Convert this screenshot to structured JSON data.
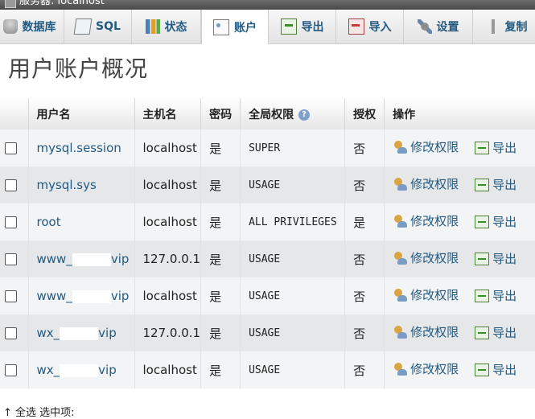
{
  "topbar": {
    "server_label": "服务器: localhost"
  },
  "tabs": [
    {
      "label": "数据库",
      "icon": "database-icon"
    },
    {
      "label": "SQL",
      "icon": "sql-icon"
    },
    {
      "label": "状态",
      "icon": "status-icon"
    },
    {
      "label": "账户",
      "icon": "accounts-icon",
      "active": true
    },
    {
      "label": "导出",
      "icon": "export-icon"
    },
    {
      "label": "导入",
      "icon": "import-icon"
    },
    {
      "label": "设置",
      "icon": "settings-icon"
    },
    {
      "label": "复制",
      "icon": "replication-icon"
    }
  ],
  "page_title": "用户账户概况",
  "table": {
    "headers": [
      "用户名",
      "主机名",
      "密码",
      "全局权限",
      "授权",
      "操作"
    ],
    "rows": [
      {
        "user_start": "mysql.session",
        "user_end": "",
        "host": "localhost",
        "password": "是",
        "privileges": "SUPER",
        "grant": "否"
      },
      {
        "user_start": "mysql.sys",
        "user_end": "",
        "host": "localhost",
        "password": "是",
        "privileges": "USAGE",
        "grant": "否"
      },
      {
        "user_start": "root",
        "user_end": "",
        "host": "localhost",
        "password": "是",
        "privileges": "ALL PRIVILEGES",
        "grant": "是"
      },
      {
        "user_start": "www_",
        "user_end": "vip",
        "host": "127.0.0.1",
        "password": "是",
        "privileges": "USAGE",
        "grant": "否"
      },
      {
        "user_start": "www_",
        "user_end": "vip",
        "host": "localhost",
        "password": "是",
        "privileges": "USAGE",
        "grant": "否"
      },
      {
        "user_start": "wx_",
        "user_end": "vip",
        "host": "127.0.0.1",
        "password": "是",
        "privileges": "USAGE",
        "grant": "否"
      },
      {
        "user_start": "wx_",
        "user_end": "vip",
        "host": "localhost",
        "password": "是",
        "privileges": "USAGE",
        "grant": "否"
      }
    ],
    "edit_label": "修改权限",
    "export_label": "导出"
  },
  "footer": {
    "text": "↑ 全选 选中项:"
  }
}
